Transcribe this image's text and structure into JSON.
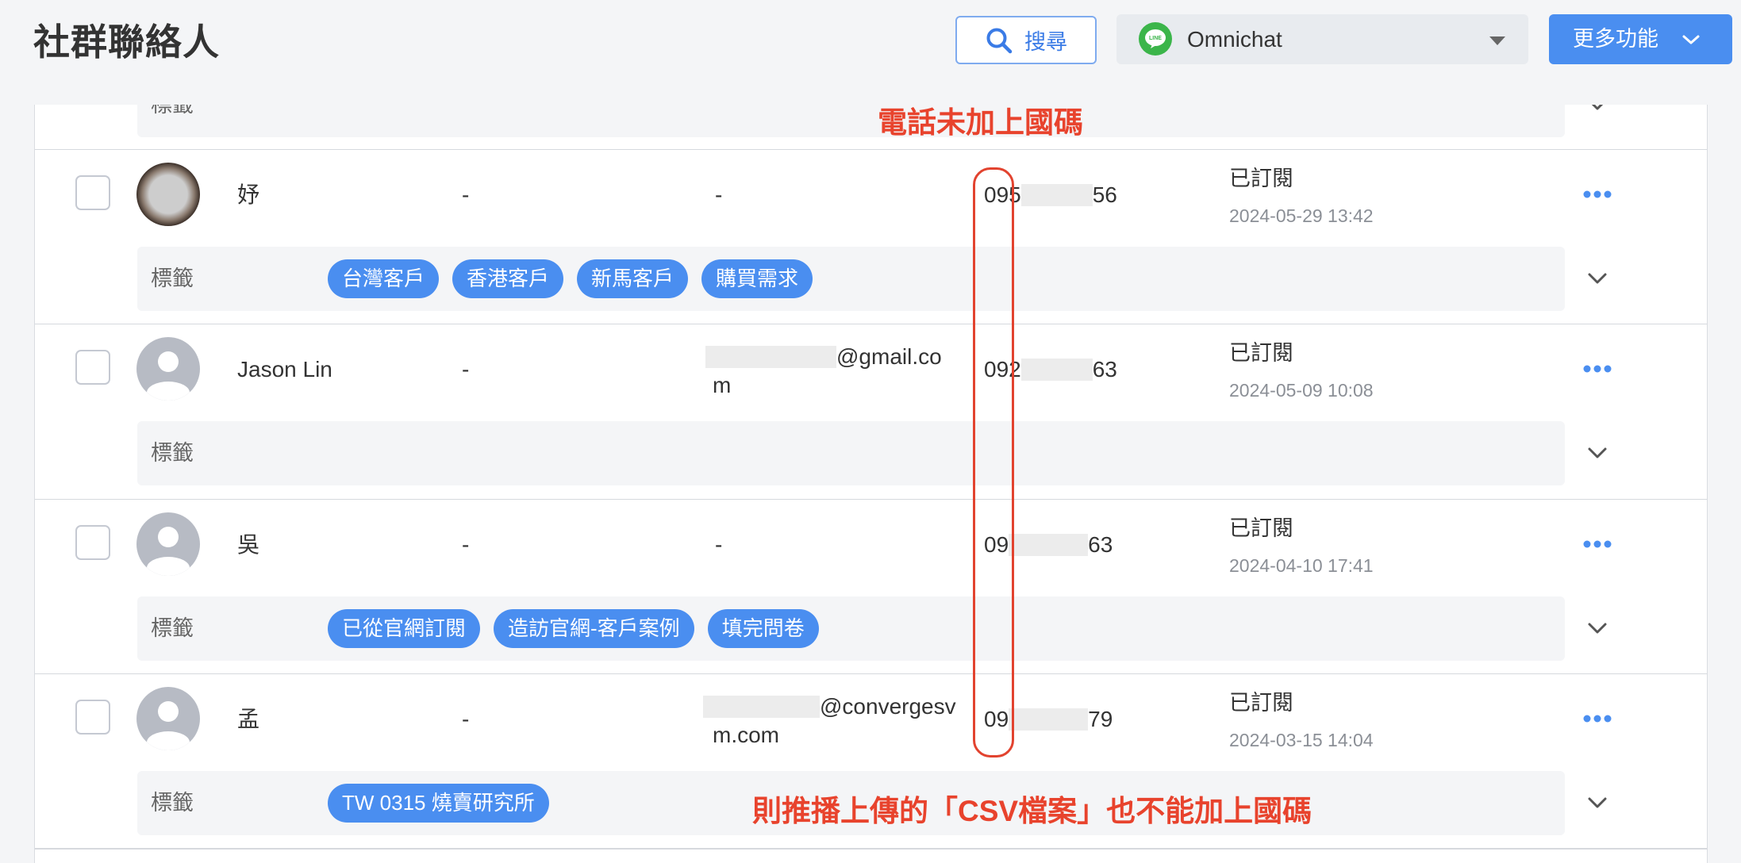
{
  "page": {
    "title": "社群聯絡人"
  },
  "toolbar": {
    "search": {
      "label": "搜尋",
      "icon": "search-icon"
    },
    "channel_select": {
      "value": "Omnichat",
      "icon": "line-logo",
      "logo_text": "LINE"
    },
    "more": {
      "label": "更多功能",
      "icon": "chevron-down-icon"
    }
  },
  "tag_section_label": "標籤",
  "contacts": [
    {
      "avatar": "photo",
      "name": "妤",
      "secondary": "-",
      "email": "-",
      "phone": {
        "prefix": "095",
        "suffix": "56"
      },
      "status": "已訂閱",
      "date": "2024-05-29 13:42",
      "tags": [
        "台灣客戶",
        "香港客戶",
        "新馬客戶",
        "購買需求"
      ]
    },
    {
      "avatar": "default-person-icon",
      "name": "Jason Lin",
      "secondary": "-",
      "email_lines": [
        "@gmail.co",
        "m"
      ],
      "phone": {
        "prefix": "092",
        "suffix": "63"
      },
      "status": "已訂閱",
      "date": "2024-05-09 10:08",
      "tags": []
    },
    {
      "avatar": "default-person-icon",
      "name": "吳",
      "secondary": "-",
      "email": "-",
      "phone": {
        "prefix": "09",
        "suffix": "63"
      },
      "status": "已訂閱",
      "date": "2024-04-10 17:41",
      "tags": [
        "已從官網訂閱",
        "造訪官網-客戶案例",
        "填完問卷"
      ]
    },
    {
      "avatar": "default-person-icon",
      "name": "孟",
      "secondary": "-",
      "email_lines": [
        "@convergesv",
        "m.com"
      ],
      "phone": {
        "prefix": "09",
        "suffix": "79"
      },
      "status": "已訂閱",
      "date": "2024-03-15 14:04",
      "tags": [
        "TW 0315 燒賣研究所"
      ]
    }
  ],
  "annotations": {
    "phone_note": "電話未加上國碼",
    "csv_note": "則推播上傳的「CSV檔案」也不能加上國碼"
  },
  "colors": {
    "accent": "#4a8ef0",
    "annotation": "#e2432f",
    "tag_bar": "#f4f5f7",
    "line_green": "#3bb54a"
  }
}
